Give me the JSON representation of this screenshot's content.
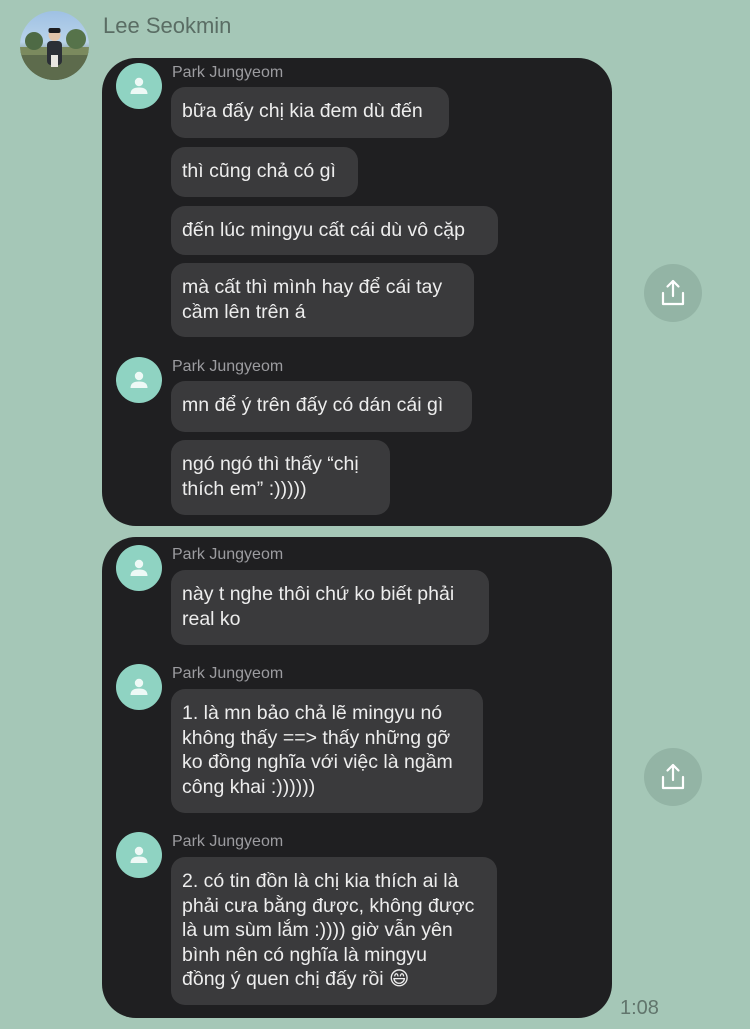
{
  "chat": {
    "sender_name": "Lee Seokmin",
    "time": "1:08"
  },
  "cards": [
    {
      "groups": [
        {
          "name": "Park Jungyeom",
          "bubbles": [
            "bữa đấy chị kia đem dù đến",
            "thì cũng chả có gì",
            "đến lúc mingyu cất cái dù vô cặp",
            "mà cất thì mình hay để cái tay\ncầm lên trên á"
          ]
        },
        {
          "name": "Park Jungyeom",
          "bubbles": [
            "mn để ý trên đấy có dán cái gì",
            "ngó ngó thì thấy “chị\nthích em” :)))))"
          ]
        }
      ]
    },
    {
      "groups": [
        {
          "name": "Park Jungyeom",
          "bubbles": [
            "này t nghe thôi chứ ko biết phải\nreal ko"
          ]
        },
        {
          "name": "Park Jungyeom",
          "bubbles": [
            "1. là mn bảo chả lẽ mingyu nó\nkhông thấy ==> thấy những gỡ\nko đồng nghĩa với việc là ngầm\ncông khai :))))))"
          ]
        },
        {
          "name": "Park Jungyeom",
          "bubbles": [
            "2. có tin đồn là chị kia thích ai là\nphải cưa bằng được, không được\nlà um sùm lắm :)))) giờ vẫn yên\nbình nên có nghĩa là mingyu\nđồng ý quen chị đấy rồi 😄"
          ]
        }
      ]
    }
  ],
  "icons": {
    "share": "share-icon",
    "avatar_placeholder": "person-icon"
  },
  "colors": {
    "background": "#a5c7b7",
    "card": "#1f1f21",
    "bubble": "#3a3a3c",
    "avatar": "#8fd3c2",
    "share_button": "#93b4a5"
  }
}
